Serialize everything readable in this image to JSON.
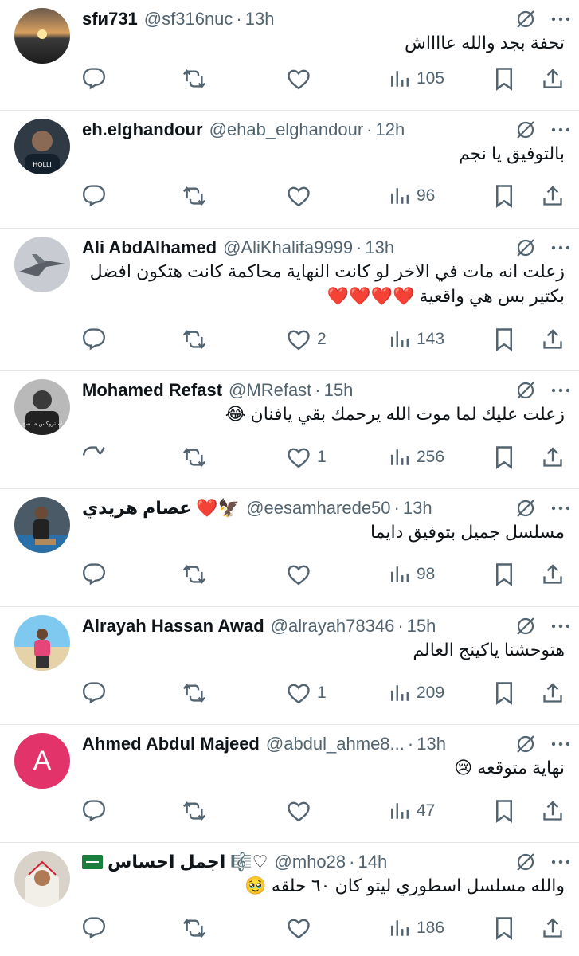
{
  "tweets": [
    {
      "name": "sfи731",
      "handle": "@sf316nuc",
      "time": "13h",
      "text": "تحفة بجد والله عااااش",
      "replies": "",
      "likes": "",
      "views": "105",
      "avatar": {
        "type": "sunset"
      }
    },
    {
      "name": "eh.elghandour",
      "handle": "@ehab_elghandour",
      "time": "12h",
      "text": "بالتوفيق يا نجم",
      "replies": "",
      "likes": "",
      "views": "96",
      "avatar": {
        "type": "person-dark"
      }
    },
    {
      "name": "Ali AbdAlhamed",
      "handle": "@AliKhalifa9999",
      "time": "13h",
      "text": "زعلت انه مات في الاخر لو كانت النهاية محاكمة كانت هتكون افضل بكتير بس هي واقعية ❤️❤️❤️❤️",
      "replies": "",
      "likes": "2",
      "views": "143",
      "avatar": {
        "type": "jet"
      }
    },
    {
      "name": "Mohamed Refast",
      "handle": "@MRefast",
      "time": "15h",
      "text": "زعلت عليك لما موت الله يرحمك بقي يافنان 😂",
      "replies": "",
      "likes": "1",
      "views": "256",
      "avatar": {
        "type": "bw-person"
      }
    },
    {
      "name": "عصام هريدي ❤️🦅",
      "handle": "@eesamharede50",
      "time": "13h",
      "text": "مسلسل جميل بتوفيق دايما",
      "replies": "",
      "likes": "",
      "views": "98",
      "avatar": {
        "type": "person-sitting"
      }
    },
    {
      "name": "Alrayah Hassan Awad",
      "handle": "@alrayah78346",
      "time": "15h",
      "text": "هتوحشنا ياكينج العالم",
      "replies": "",
      "likes": "1",
      "views": "209",
      "avatar": {
        "type": "beach"
      }
    },
    {
      "name": "Ahmed Abdul Majeed",
      "handle": "@abdul_ahme8...",
      "time": "13h",
      "text": "نهاية متوقعه 😢",
      "replies": "",
      "likes": "",
      "views": "47",
      "avatar": {
        "type": "letter",
        "letter": "A"
      }
    },
    {
      "name": "اجمل احساس 🎼♡",
      "handle": "@mho28",
      "time": "14h",
      "text": "والله مسلسل اسطوري ليتو كان ٦٠ حلقه 🥹",
      "replies": "",
      "likes": "",
      "views": "186",
      "avatar": {
        "type": "person-shemagh"
      },
      "flag": true
    }
  ],
  "colors": {
    "text": "#0f1419",
    "muted": "#536471",
    "divider": "#e6e9ec",
    "letter_avatar": "#e2336b"
  }
}
